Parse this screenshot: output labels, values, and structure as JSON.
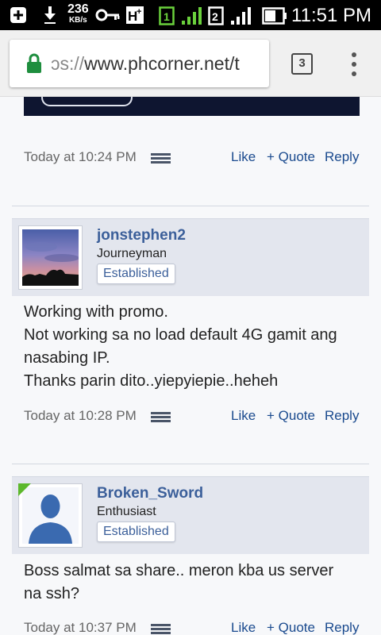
{
  "status_bar": {
    "speed_value": "236",
    "speed_unit": "KB/s",
    "time": "11:51 PM",
    "sim1": "1",
    "sim2": "2",
    "icons": [
      "add-icon",
      "download-icon",
      "key-icon",
      "hplus-icon",
      "sim1-icon",
      "signal-icon",
      "sim2-icon",
      "signal-icon",
      "battery-icon"
    ]
  },
  "browser": {
    "url_prefix": "ɔs://",
    "url_main": "www.phcorner.net/t",
    "tab_count": "3",
    "colors": {
      "lock": "#1e8e3e"
    }
  },
  "posts": [
    {
      "timestamp": "Today at 10:24 PM",
      "actions": {
        "like": "Like",
        "quote": "+ Quote",
        "reply": "Reply"
      }
    },
    {
      "username": "jonstephen2",
      "user_title": "Journeyman",
      "badge": "Established",
      "message_lines": [
        "Working with promo.",
        "Not working sa no load default 4G gamit ang",
        "nasabing IP.",
        "Thanks parin dito..yiepyiepie..heheh"
      ],
      "timestamp": "Today at 10:28 PM",
      "actions": {
        "like": "Like",
        "quote": "+ Quote",
        "reply": "Reply"
      }
    },
    {
      "username": "Broken_Sword",
      "user_title": "Enthusiast",
      "badge": "Established",
      "message_lines": [
        "Boss salmat sa share.. meron kba us server",
        "na ssh?"
      ],
      "timestamp": "Today at 10:37 PM",
      "actions": {
        "like": "Like",
        "quote": "+ Quote",
        "reply": "Reply"
      }
    }
  ],
  "colors": {
    "username": "#3b5f9a",
    "action_link": "#1a4a8e",
    "userbar_bg": "#e3e6ee",
    "page_bg": "#f7f8fa"
  }
}
